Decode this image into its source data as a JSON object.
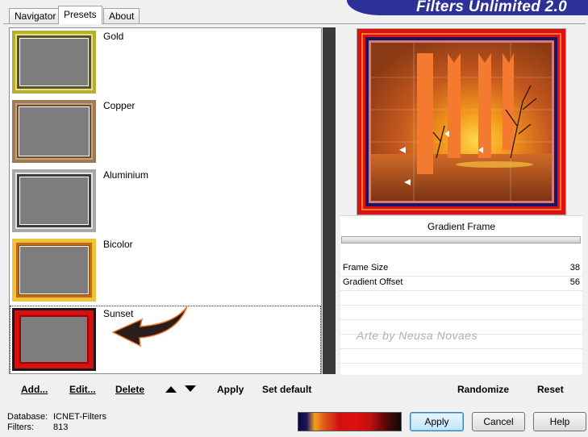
{
  "tabs": [
    {
      "label": "Navigator"
    },
    {
      "label": "Presets"
    },
    {
      "label": "About"
    }
  ],
  "app_title": "Filters Unlimited 2.0",
  "presets": [
    {
      "name": "Gold",
      "outer": "#b6ad33",
      "inner": "#57522a",
      "mid": "#e8e07a"
    },
    {
      "name": "Copper",
      "outer": "#9e7a57",
      "inner": "#6b4b2c",
      "mid": "#c9a47a"
    },
    {
      "name": "Aluminium",
      "outer": "#a7a7a7",
      "inner": "#3d3d3d",
      "mid": "#e4e4e4"
    },
    {
      "name": "Bicolor",
      "outer": "#f0c23c",
      "inner": "#c06a14",
      "mid": "#8a4b0a"
    },
    {
      "name": "Sunset",
      "outer": "#1a1a1a",
      "inner": "#d61010",
      "mid": "#a00000"
    }
  ],
  "toolbar": {
    "add": "Add...",
    "edit": "Edit...",
    "delete": "Delete",
    "apply": "Apply",
    "set_default": "Set default"
  },
  "filter": {
    "name": "Gradient Frame",
    "params": [
      {
        "label": "Frame Size",
        "value": "38"
      },
      {
        "label": "Gradient Offset",
        "value": "56"
      }
    ],
    "watermark": "Arte by Neusa Novaes"
  },
  "right_buttons": {
    "randomize": "Randomize",
    "reset": "Reset"
  },
  "footer": {
    "database_label": "Database:",
    "database_value": "ICNET-Filters",
    "filters_label": "Filters:",
    "filters_value": "813",
    "apply": "Apply",
    "cancel": "Cancel",
    "help": "Help"
  },
  "colors": {
    "banner": "#2d3096",
    "accent_orange": "#f47a30",
    "frame_red": "#e01010",
    "frame_navy": "#1c1460"
  }
}
